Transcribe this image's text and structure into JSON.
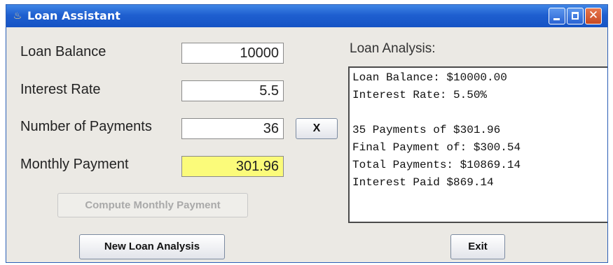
{
  "window": {
    "title": "Loan Assistant",
    "close_glyph": "✕"
  },
  "form": {
    "balance_label": "Loan Balance",
    "balance_value": "10000",
    "rate_label": "Interest Rate",
    "rate_value": "5.5",
    "payments_label": "Number of Payments",
    "payments_value": "36",
    "monthly_label": "Monthly Payment",
    "monthly_value": "301.96",
    "clear_label": "X"
  },
  "buttons": {
    "compute_label": "Compute Monthly Payment",
    "new_analysis_label": "New Loan Analysis",
    "exit_label": "Exit"
  },
  "analysis": {
    "label": "Loan Analysis:",
    "lines": [
      "Loan Balance: $10000.00",
      "Interest Rate: 5.50%",
      "",
      "35 Payments of $301.96",
      "Final Payment of: $300.54",
      "Total Payments: $10869.14",
      "Interest Paid $869.14"
    ]
  },
  "colors": {
    "title_bar": "#1f5fd0",
    "payment_field_bg": "#fbfb7a",
    "window_bg": "#ebe9e4"
  },
  "icons": {
    "app": "java-coffee-icon",
    "minimize": "minimize-icon",
    "maximize": "maximize-icon",
    "close": "close-icon"
  }
}
